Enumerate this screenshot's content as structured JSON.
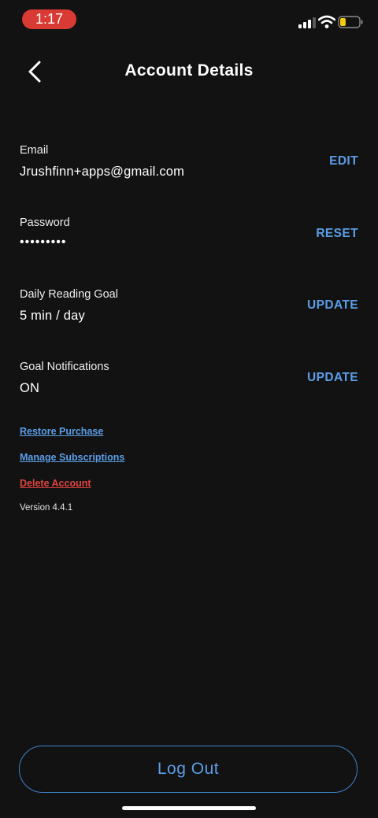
{
  "status_bar": {
    "time": "1:17",
    "time_pill_color": "#d93a33",
    "signal_icon": "cellular-signal-icon",
    "wifi_icon": "wifi-icon",
    "battery_icon": "battery-icon",
    "battery_level": 0.3
  },
  "header": {
    "title": "Account Details",
    "back_icon": "chevron-left-icon"
  },
  "rows": [
    {
      "label": "Email",
      "value": "Jrushfinn+apps@gmail.com",
      "action": "EDIT"
    },
    {
      "label": "Password",
      "value": "•••••••••",
      "action": "RESET"
    },
    {
      "label": "Daily Reading Goal",
      "value": "5 min / day",
      "action": "UPDATE"
    },
    {
      "label": "Goal Notifications",
      "value": "ON",
      "action": "UPDATE"
    }
  ],
  "links": {
    "restore_purchase": "Restore Purchase",
    "manage_subscriptions": "Manage Subscriptions",
    "delete_account": "Delete Account"
  },
  "version": "Version 4.4.1",
  "logout_label": "Log Out",
  "colors": {
    "background": "#121212",
    "accent_blue": "#5b9ee6",
    "danger_red": "#e0443e"
  }
}
